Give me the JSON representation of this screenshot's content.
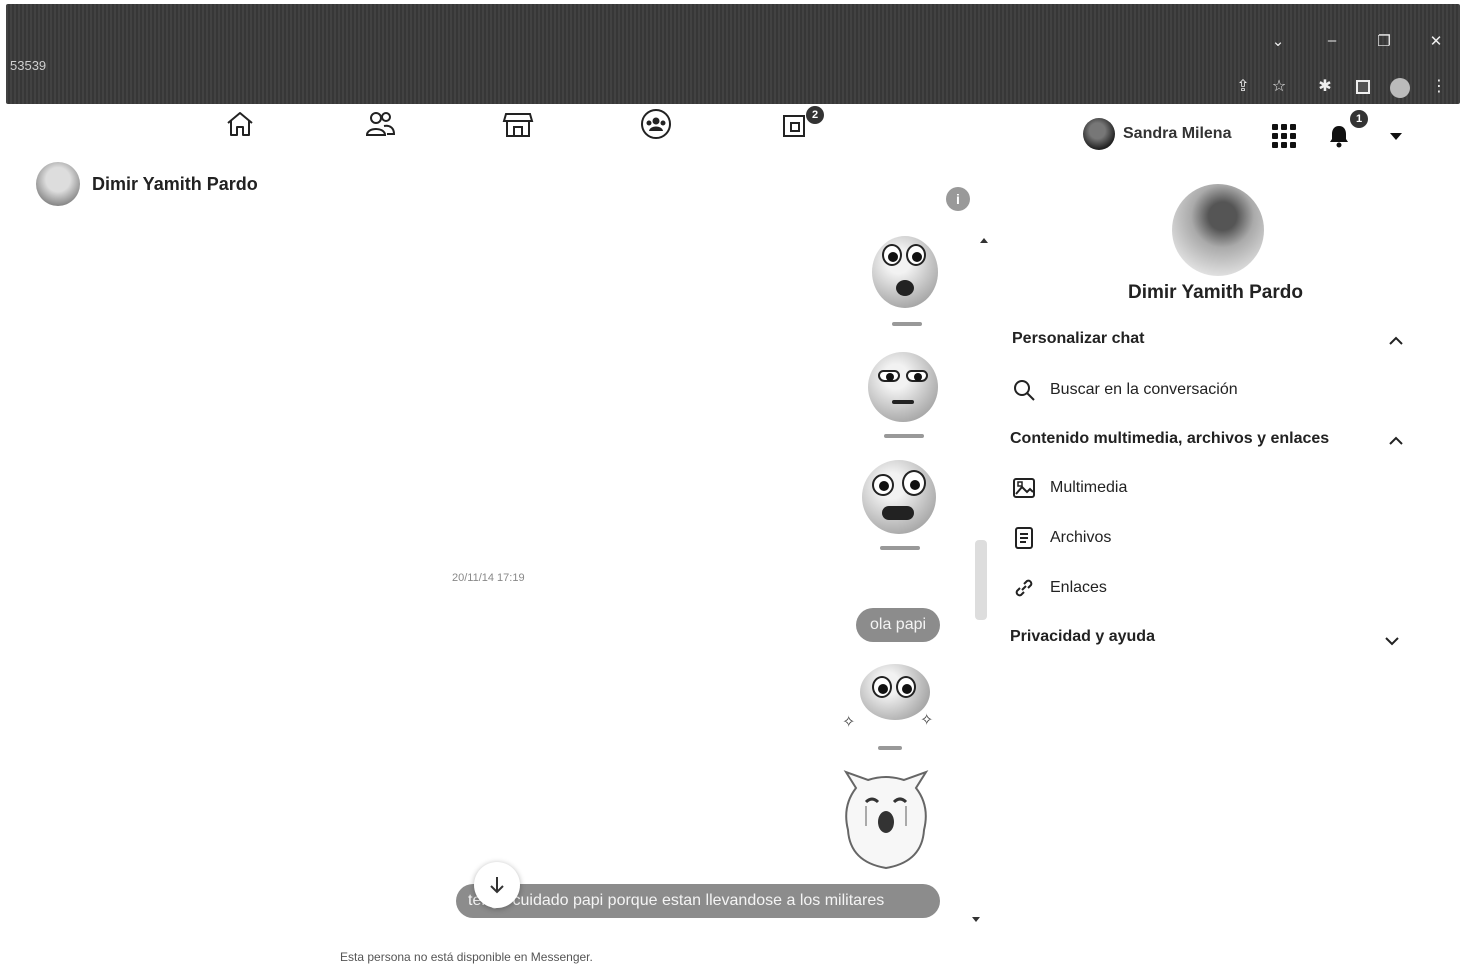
{
  "browser": {
    "tab_id": "53539",
    "window_controls": [
      "chevron-down-icon",
      "minimize-icon",
      "restore-icon",
      "close-icon"
    ],
    "toolbar_icons": [
      "share-icon",
      "star-icon",
      "puzzle-icon",
      "sidepanel-icon",
      "profile-icon",
      "kebab-icon"
    ]
  },
  "nav": {
    "icons": [
      "home-icon",
      "friends-icon",
      "marketplace-icon",
      "groups-icon",
      "gaming-icon"
    ],
    "gaming_badge": "2",
    "account_name": "Sandra Milena",
    "notifications_badge": "1"
  },
  "chat": {
    "contact_name": "Dimir Yamith Pardo",
    "info_icon": "i",
    "timestamp": "20/11/14 17:19",
    "messages": [
      {
        "type": "sticker",
        "name": "surprised-face-sticker"
      },
      {
        "type": "sticker",
        "name": "annoyed-face-sticker"
      },
      {
        "type": "sticker",
        "name": "worried-face-sticker"
      },
      {
        "type": "text",
        "text": "ola papi"
      },
      {
        "type": "sticker",
        "name": "sparkle-face-sticker"
      },
      {
        "type": "sticker",
        "name": "crying-cat-sticker"
      },
      {
        "type": "text",
        "text": "tenga cuidado   papi  porque  estan   llevandose a los  militares"
      }
    ],
    "unavailable_notice": "Esta persona no está disponible en Messenger."
  },
  "panel": {
    "name": "Dimir Yamith Pardo",
    "customize_chat": "Personalizar chat",
    "search_in_conversation": "Buscar en la conversación",
    "media_section": "Contenido multimedia, archivos y enlaces",
    "media": "Multimedia",
    "files": "Archivos",
    "links": "Enlaces",
    "privacy_help": "Privacidad y ayuda"
  }
}
